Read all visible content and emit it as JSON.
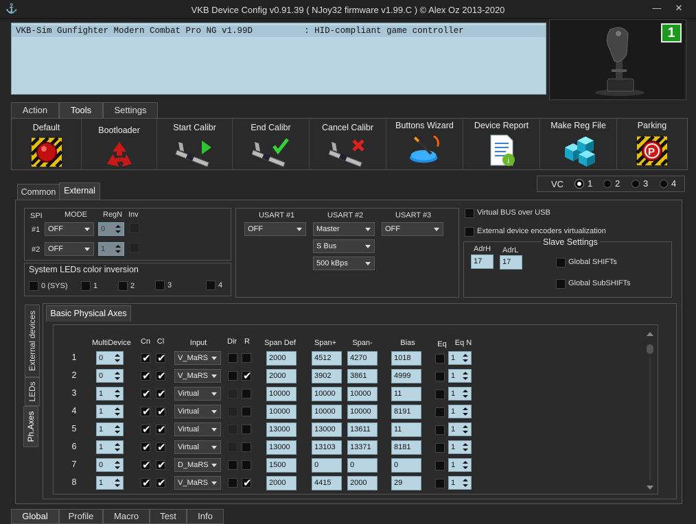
{
  "window": {
    "title": "VKB Device Config v0.91.39 ( NJoy32 firmware v1.99.C ) © Alex Oz 2013-2020",
    "min_glyph": "—",
    "close_glyph": "✕"
  },
  "device_list": {
    "row": "VKB-Sim Gunfighter Modern Combat Pro NG v1.99D          : HID-compliant game controller"
  },
  "device_badge": "1",
  "main_tabs": [
    {
      "label": "Action"
    },
    {
      "label": "Tools"
    },
    {
      "label": "Settings"
    }
  ],
  "toolbar": [
    {
      "label": "Default"
    },
    {
      "label": "Bootloader"
    },
    {
      "label": "Start Calibr"
    },
    {
      "label": "End Calibr"
    },
    {
      "label": "Cancel Calibr"
    },
    {
      "label": "Buttons Wizard"
    },
    {
      "label": "Device Report"
    },
    {
      "label": "Make Reg File"
    },
    {
      "label": "Parking"
    }
  ],
  "sub_tabs": [
    {
      "label": "Common"
    },
    {
      "label": "External"
    }
  ],
  "vc": {
    "label": "VC",
    "options": [
      "1",
      "2",
      "3",
      "4"
    ],
    "selected": "1"
  },
  "spi": {
    "hdr_spi": "SPI",
    "hdr_mode": "MODE",
    "hdr_regn": "RegN",
    "hdr_inv": "Inv",
    "rows": [
      {
        "label": "#1",
        "mode": "OFF",
        "regn": "0"
      },
      {
        "label": "#2",
        "mode": "OFF",
        "regn": "1"
      }
    ]
  },
  "leds_inv": {
    "title": "System LEDs color inversion",
    "items": [
      "0 (SYS)",
      "1",
      "2",
      "3",
      "4"
    ]
  },
  "usart": {
    "h1": "USART #1",
    "h2": "USART #2",
    "h3": "USART #3",
    "u1": "OFF",
    "u2": "Master",
    "u2_bus": "S Bus",
    "u2_baud": "500 kBps",
    "u3": "OFF"
  },
  "virtual": {
    "bus_usb": "Virtual BUS over USB",
    "encoders": "External device encoders virtualization"
  },
  "slave": {
    "title": "Slave Settings",
    "adrh_label": "AdrH",
    "adrh": "17",
    "adrl_label": "AdrL",
    "adrl": "17",
    "shifts": "Global SHIFTs",
    "subshifts": "Global SubSHIFTs"
  },
  "side_tabs": [
    "External devices",
    "LEDs",
    "Ph.Axes"
  ],
  "axes": {
    "tab": "Basic Physical Axes",
    "headers": {
      "multi": "MultiDevice",
      "cn": "Cn",
      "cl": "Cl",
      "input": "Input",
      "dir": "Dir",
      "r": "R",
      "spandef": "Span Def",
      "spanp": "Span+",
      "spanm": "Span-",
      "bias": "Bias",
      "eq": "Eq",
      "eqn": "Eq N"
    },
    "rows": [
      {
        "n": "1",
        "multi": "0",
        "cn": true,
        "cl": true,
        "input": "V_MaRS",
        "dir": false,
        "r": false,
        "dir_dis": false,
        "spandef": "2000",
        "spanp": "4512",
        "spanm": "4270",
        "bias": "1018",
        "eqn": "1"
      },
      {
        "n": "2",
        "multi": "0",
        "cn": true,
        "cl": true,
        "input": "V_MaRS",
        "dir": false,
        "r": true,
        "dir_dis": false,
        "spandef": "2000",
        "spanp": "3902",
        "spanm": "3861",
        "bias": "4999",
        "eqn": "1"
      },
      {
        "n": "3",
        "multi": "1",
        "cn": true,
        "cl": true,
        "input": "Virtual",
        "dir": false,
        "r": false,
        "dir_dis": true,
        "spandef": "10000",
        "spanp": "10000",
        "spanm": "10000",
        "bias": "11",
        "eqn": "1"
      },
      {
        "n": "4",
        "multi": "1",
        "cn": true,
        "cl": true,
        "input": "Virtual",
        "dir": false,
        "r": false,
        "dir_dis": true,
        "spandef": "10000",
        "spanp": "10000",
        "spanm": "10000",
        "bias": "8191",
        "eqn": "1"
      },
      {
        "n": "5",
        "multi": "1",
        "cn": true,
        "cl": true,
        "input": "Virtual",
        "dir": false,
        "r": false,
        "dir_dis": true,
        "spandef": "13000",
        "spanp": "13000",
        "spanm": "13611",
        "bias": "11",
        "eqn": "1"
      },
      {
        "n": "6",
        "multi": "1",
        "cn": true,
        "cl": true,
        "input": "Virtual",
        "dir": false,
        "r": false,
        "dir_dis": true,
        "spandef": "13000",
        "spanp": "13103",
        "spanm": "13371",
        "bias": "8181",
        "eqn": "1"
      },
      {
        "n": "7",
        "multi": "0",
        "cn": true,
        "cl": true,
        "input": "D_MaRS",
        "dir": false,
        "r": false,
        "dir_dis": false,
        "spandef": "1500",
        "spanp": "0",
        "spanm": "0",
        "bias": "0",
        "eqn": "1"
      },
      {
        "n": "8",
        "multi": "1",
        "cn": true,
        "cl": true,
        "input": "V_MaRS",
        "dir": false,
        "r": true,
        "dir_dis": false,
        "spandef": "2000",
        "spanp": "4415",
        "spanm": "2000",
        "bias": "29",
        "eqn": "1"
      }
    ]
  },
  "bottom_tabs": [
    {
      "label": "Global"
    },
    {
      "label": "Profile"
    },
    {
      "label": "Macro"
    },
    {
      "label": "Test"
    },
    {
      "label": "Info"
    }
  ]
}
